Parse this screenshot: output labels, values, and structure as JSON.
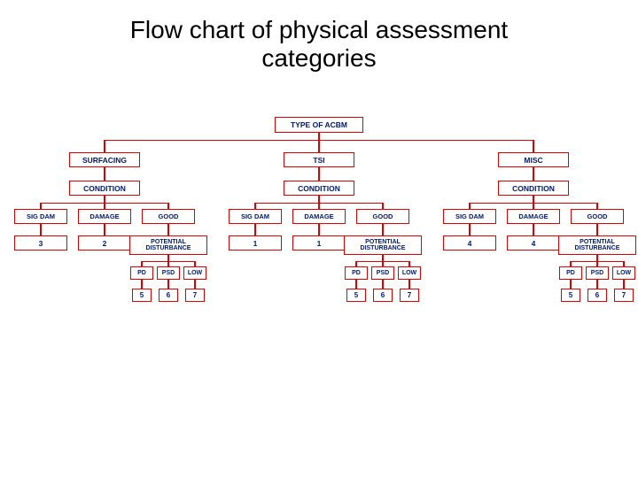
{
  "title_line1": "Flow chart of physical assessment",
  "title_line2": "categories",
  "root": "TYPE OF ACBM",
  "branches": [
    {
      "name": "SURFACING",
      "condition": "CONDITION",
      "states": [
        "SIG DAM",
        "DAMAGE",
        "GOOD"
      ],
      "values": [
        "3",
        "2",
        "POTENTIAL DISTURBANCE"
      ],
      "pd_children": [
        "PD",
        "PSD",
        "LOW"
      ],
      "pd_values": [
        "5",
        "6",
        "7"
      ]
    },
    {
      "name": "TSI",
      "condition": "CONDITION",
      "states": [
        "SIG DAM",
        "DAMAGE",
        "GOOD"
      ],
      "values": [
        "1",
        "1",
        "POTENTIAL DISTURBANCE"
      ],
      "pd_children": [
        "PD",
        "PSD",
        "LOW"
      ],
      "pd_values": [
        "5",
        "6",
        "7"
      ]
    },
    {
      "name": "MISC",
      "condition": "CONDITION",
      "states": [
        "SIG DAM",
        "DAMAGE",
        "GOOD"
      ],
      "values": [
        "4",
        "4",
        "POTENTIAL DISTURBANCE"
      ],
      "pd_children": [
        "PD",
        "PSD",
        "LOW"
      ],
      "pd_values": [
        "5",
        "6",
        "7"
      ]
    }
  ]
}
